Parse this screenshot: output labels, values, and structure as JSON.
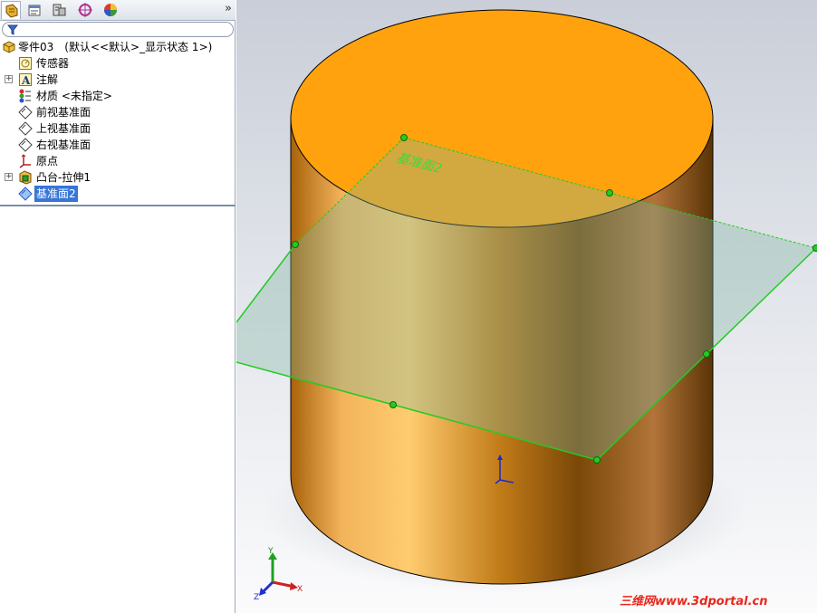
{
  "tabs": [
    {
      "name": "featuremanager-tab",
      "icon": "featuremanager-icon"
    },
    {
      "name": "propertymanager-tab",
      "icon": "propertymanager-icon"
    },
    {
      "name": "configurationmanager-tab",
      "icon": "configurationmanager-icon"
    },
    {
      "name": "dimxpert-tab",
      "icon": "dimxpert-icon"
    },
    {
      "name": "display-manager-tab",
      "icon": "display-manager-icon"
    }
  ],
  "tabbar": {
    "more": "»"
  },
  "tree": {
    "root": "零件03　(默认<<默认>_显示状态 1>)",
    "items": [
      {
        "label": "传感器",
        "icon": "sensor-icon",
        "expand": false
      },
      {
        "label": "注解",
        "icon": "annotation-icon",
        "expand": true
      },
      {
        "label": "材质 <未指定>",
        "icon": "material-icon",
        "expand": false
      },
      {
        "label": "前视基准面",
        "icon": "plane-icon",
        "expand": false
      },
      {
        "label": "上视基准面",
        "icon": "plane-icon",
        "expand": false
      },
      {
        "label": "右视基准面",
        "icon": "plane-icon",
        "expand": false
      },
      {
        "label": "原点",
        "icon": "origin-icon",
        "expand": false
      },
      {
        "label": "凸台-拉伸1",
        "icon": "extrude-icon",
        "expand": true
      },
      {
        "label": "基准面2",
        "icon": "plane-icon",
        "expand": false,
        "selected": true
      }
    ]
  },
  "viewport": {
    "plane_label": "基准面2",
    "triad": {
      "x": "X",
      "y": "Y",
      "z": "Z"
    },
    "colors": {
      "body": "#f5a11a",
      "plane_edge": "#22cc22",
      "plane_fill": "#7fb5a0"
    }
  },
  "watermark": "三维网www.3dportal.cn"
}
